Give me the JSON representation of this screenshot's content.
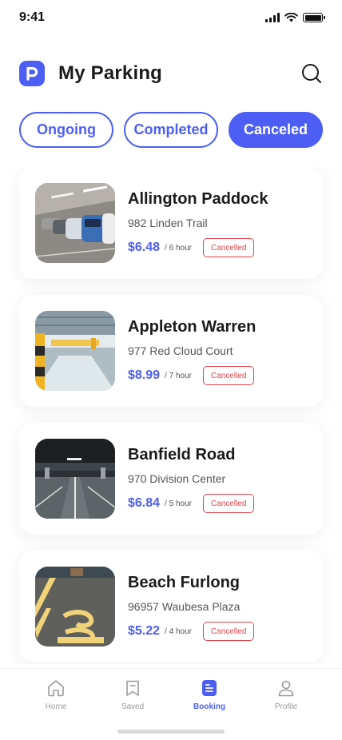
{
  "status_bar": {
    "time": "9:41"
  },
  "header": {
    "title": "My Parking"
  },
  "tabs": [
    {
      "label": "Ongoing",
      "active": false
    },
    {
      "label": "Completed",
      "active": false
    },
    {
      "label": "Canceled",
      "active": true
    }
  ],
  "bookings": [
    {
      "name": "Allington Paddock",
      "address": "982 Linden Trail",
      "price": "$6.48",
      "duration": "/ 6 hour",
      "status": "Cancelled"
    },
    {
      "name": "Appleton Warren",
      "address": "977 Red Cloud Court",
      "price": "$8.99",
      "duration": "/ 7 hour",
      "status": "Cancelled"
    },
    {
      "name": "Banfield Road",
      "address": "970 Division Center",
      "price": "$6.84",
      "duration": "/ 5 hour",
      "status": "Cancelled"
    },
    {
      "name": "Beach Furlong",
      "address": "96957 Waubesa Plaza",
      "price": "$5.22",
      "duration": "/ 4 hour",
      "status": "Cancelled"
    }
  ],
  "bottom_nav": [
    {
      "label": "Home",
      "icon": "home-icon",
      "active": false
    },
    {
      "label": "Saved",
      "icon": "bookmark-icon",
      "active": false
    },
    {
      "label": "Booking",
      "icon": "booking-icon",
      "active": true
    },
    {
      "label": "Profile",
      "icon": "profile-icon",
      "active": false
    }
  ],
  "colors": {
    "primary": "#4d5ef5",
    "cancelled": "#e0454b",
    "text": "#1b1b1b",
    "muted": "#9a9a9a"
  }
}
